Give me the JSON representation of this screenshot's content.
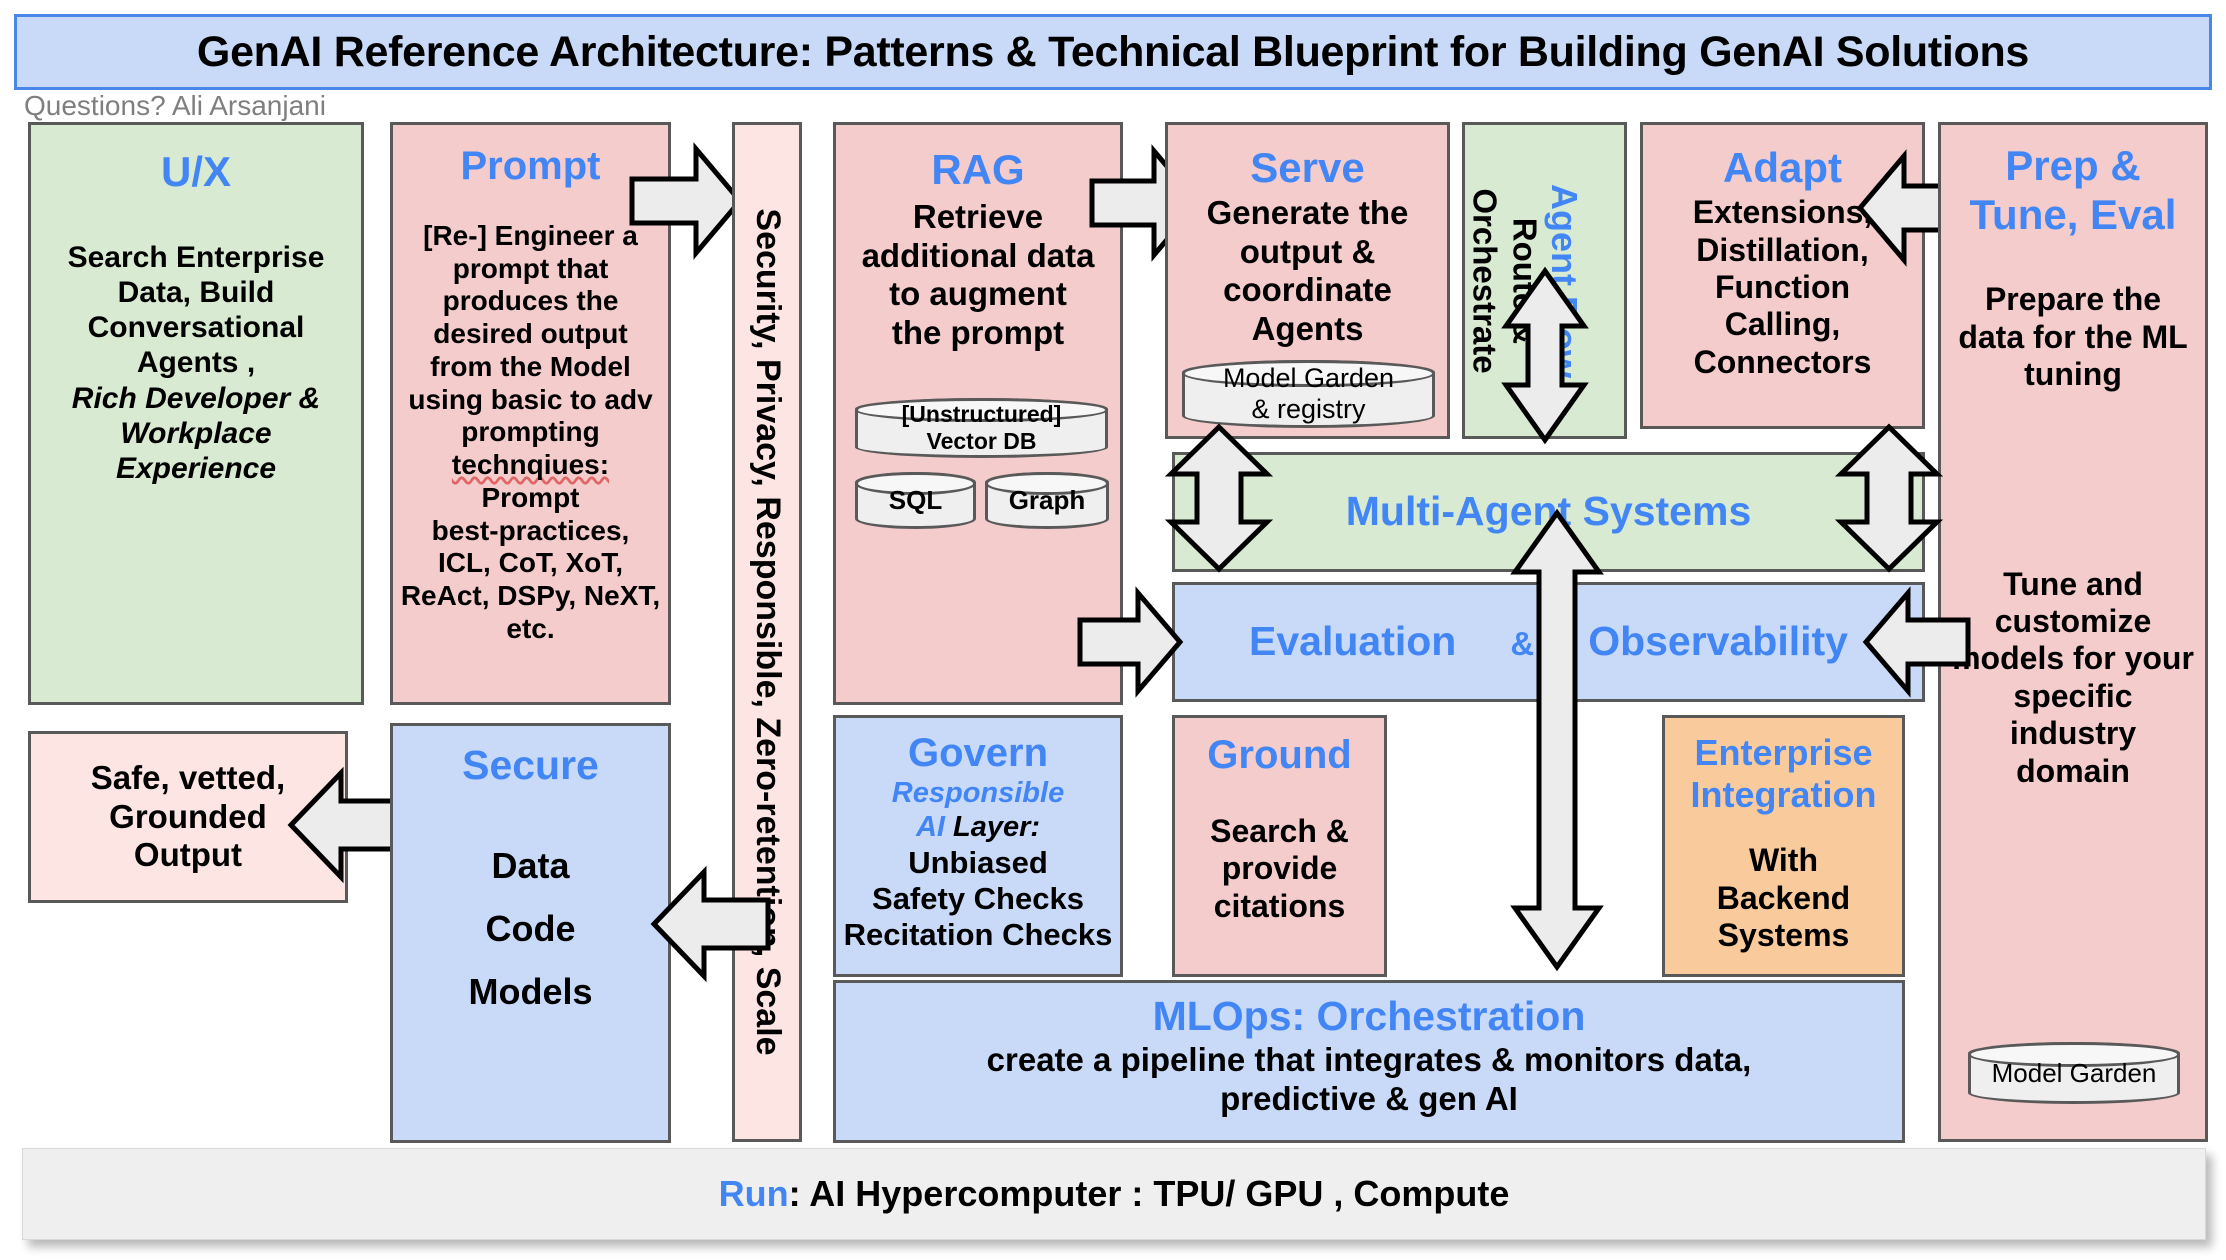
{
  "title": "GenAI Reference Architecture: Patterns & Technical Blueprint for Building GenAI Solutions",
  "byline": "Questions? Ali Arsanjani",
  "colors": {
    "accent_blue": "#4285f4",
    "title_band": "#c9daf8",
    "green": "#d9ead3",
    "pink": "#f4cccc",
    "light_pink": "#fce5e3",
    "blue": "#c9daf8",
    "orange": "#f9cb9c",
    "grey": "#efefef",
    "border": "#595959"
  },
  "panels": {
    "ux": {
      "heading": "U/X",
      "line1": "Search Enterprise",
      "line2": "Data, Build",
      "line3": "Conversational",
      "line4": "Agents ,",
      "em1": "Rich Developer &",
      "em2": "Workplace",
      "em3": "Experience"
    },
    "prompt": {
      "heading": "Prompt",
      "l1": "[Re-] Engineer a",
      "l2": "prompt that",
      "l3": "produces the",
      "l4": "desired output",
      "l5": "from the Model",
      "l6": "using basic to adv",
      "l7": "prompting",
      "l8": "technqiues:",
      "l9": "Prompt",
      "l10": "best-practices,",
      "l11": "ICL, CoT, XoT,",
      "l12": "ReAct, DSPy, NeXT,",
      "l13": "etc."
    },
    "security": {
      "label": "Security, Privacy, Responsible, Zero-retention, Scale"
    },
    "rag": {
      "heading": "RAG",
      "l1": "Retrieve",
      "l2": "additional data",
      "l3": "to augment",
      "l4": "the prompt",
      "db_vector_a": "[Unstructured]",
      "db_vector_b": "Vector DB",
      "db_sql": "SQL",
      "db_graph": "Graph"
    },
    "serve": {
      "heading": "Serve",
      "l1": "Generate the",
      "l2": "output &",
      "l3": "coordinate",
      "l4": "Agents",
      "db_a": "Model Garden",
      "db_b": "& registry"
    },
    "agent_flow": {
      "heading": "Agent Flow",
      "sub_a": "Route &",
      "sub_b": "Orchestrate"
    },
    "adapt": {
      "heading": "Adapt",
      "l1": "Extensions,",
      "l2": "Distillation,",
      "l3": "Function",
      "l4": "Calling,",
      "l5": "Connectors"
    },
    "prep_tune": {
      "heading_a": "Prep &",
      "heading_b": "Tune, Eval",
      "l1": "Prepare the",
      "l2": "data for the ML",
      "l3": "tuning",
      "m1": "Tune and",
      "m2": "customize",
      "m3": "models for your",
      "m4": "specific",
      "m5": "industry",
      "m6": "domain",
      "db": "Model Garden"
    },
    "multi_agent": {
      "heading": "Multi-Agent Systems"
    },
    "evaluation": {
      "a": "Evaluation",
      "amp": "&",
      "b": "Observability"
    },
    "safe_output": {
      "l1": "Safe, vetted,",
      "l2": "Grounded",
      "l3": "Output"
    },
    "secure": {
      "heading": "Secure",
      "l1": "Data",
      "l2": "Code",
      "l3": "Models"
    },
    "govern": {
      "heading": "Govern",
      "sub_blue": "Responsible",
      "sub_blue2": "AI",
      "sub_black": "Layer:",
      "l1": "Unbiased",
      "l2": "Safety Checks",
      "l3": "Recitation Checks"
    },
    "ground": {
      "heading": "Ground",
      "l1": "Search &",
      "l2": "provide",
      "l3": "citations"
    },
    "enterprise": {
      "heading_a": "Enterprise",
      "heading_b": "Integration",
      "l1": "With",
      "l2": "Backend",
      "l3": "Systems"
    },
    "mlops": {
      "heading": "MLOps: Orchestration",
      "l1": "create a pipeline that integrates & monitors  data,",
      "l2": "predictive & gen AI"
    },
    "run": {
      "accent": "Run",
      "rest": ": AI Hypercomputer : TPU/ GPU , Compute"
    }
  }
}
